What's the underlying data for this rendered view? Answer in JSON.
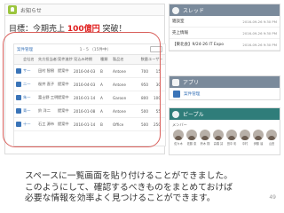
{
  "notice": {
    "title": "お知らせ",
    "target_prefix": "目標：今期売上 ",
    "target_highlight": "100億円",
    "target_suffix": " 突破！"
  },
  "grid": {
    "title": "案件管理",
    "count": "1 - 5 （15件中）",
    "headers": [
      "",
      "会社名",
      "先方担当者名",
      "案件進捗",
      "見込み時期",
      "種類",
      "製品名",
      "数量",
      "ユーザー数"
    ],
    "rows": [
      [
        "",
        "サ一",
        "田村 智樹",
        "提案中",
        "2016-04-03",
        "B",
        "Antone",
        "700",
        "15"
      ],
      [
        "",
        "二一",
        "桜井 直子",
        "提案中",
        "2016-04-03",
        "A",
        "Antone",
        "950",
        "30"
      ],
      [
        "",
        "朱一",
        "富士野 工明",
        "提案中",
        "2016-01-14",
        "A",
        "Garoon",
        "800",
        "100"
      ],
      [
        "",
        "青一",
        "鈴 洋二",
        "提案中",
        "2016-01-08",
        "A",
        "Antone",
        "500",
        "55"
      ],
      [
        "",
        "十一",
        "石工 源市",
        "提案中",
        "2016-01-14",
        "B",
        "Office",
        "500",
        "250"
      ]
    ]
  },
  "thread": {
    "title": "スレッド",
    "items": [
      {
        "name": "雑談室",
        "time": "2016-09-26 9:30 PM"
      },
      {
        "name": "売上情報",
        "time": "2016-09-26 9:30 PM"
      },
      {
        "name": "【東北会】9/24-26 IT Expo",
        "time": "2016-09-26 9:30 PM"
      }
    ]
  },
  "app": {
    "title": "アプリ",
    "items": [
      {
        "name": "案件管理"
      }
    ]
  },
  "people": {
    "title": "ピープル",
    "members_label": "メンバー",
    "members": [
      {
        "name": "佐々木"
      },
      {
        "name": "佐藤 恵"
      },
      {
        "name": "鈴木 翔"
      },
      {
        "name": "高橋 詩"
      },
      {
        "name": "田中 彩"
      },
      {
        "name": "中村"
      },
      {
        "name": "伊藤 達"
      },
      {
        "name": "山田"
      }
    ]
  },
  "caption": {
    "lines": [
      "スペースに一覧画面を貼り付けることができました。",
      "このようにして、確認するべきものをまとめておけば",
      "必要な情報を効率よく見つけることができます。"
    ],
    "page_number": "49"
  }
}
